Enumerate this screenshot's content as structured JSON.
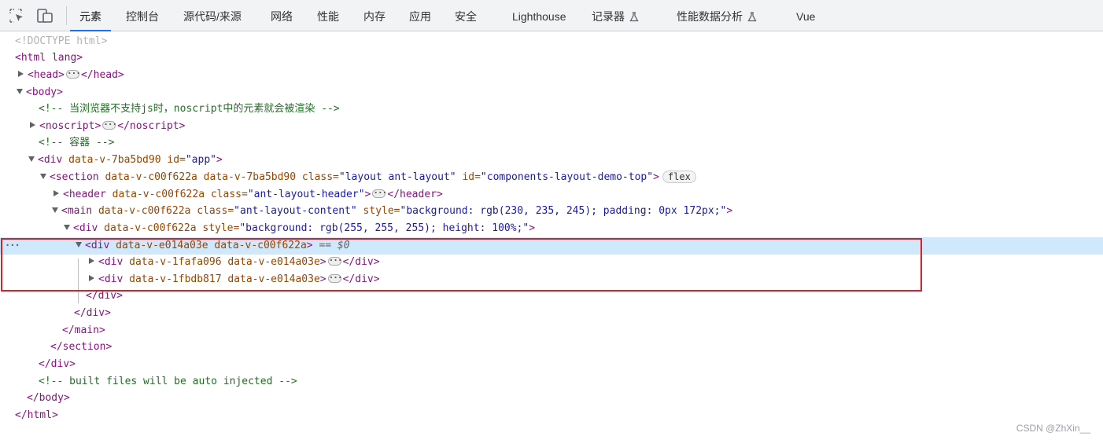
{
  "toolbar": {
    "icons": [
      "inspect-element-icon",
      "device-toolbar-icon"
    ],
    "tabs": [
      {
        "label": "元素",
        "active": true
      },
      {
        "label": "控制台"
      },
      {
        "label": "源代码/来源"
      },
      {
        "label": "网络"
      },
      {
        "label": "性能"
      },
      {
        "label": "内存"
      },
      {
        "label": "应用"
      },
      {
        "label": "安全"
      },
      {
        "label": "Lighthouse"
      },
      {
        "label": "记录器",
        "flask": true
      },
      {
        "label": "性能数据分析",
        "flask": true
      },
      {
        "label": "Vue"
      }
    ]
  },
  "tree": {
    "doctype": "<!DOCTYPE html>",
    "html_open": "<html lang>",
    "head_open": "<head>",
    "head_close": "</head>",
    "body_open": "<body>",
    "comment1": "<!-- 当浏览器不支持js时，noscript中的元素就会被渲染 -->",
    "noscript_open": "<noscript>",
    "noscript_close": "</noscript>",
    "comment2": "<!-- 容器 -->",
    "app_div": {
      "tag": "<div",
      "a1": "data-v-7ba5bd90",
      "a2": "id=",
      "v2": "\"app\"",
      "end": ">"
    },
    "section": {
      "tag": "<section",
      "a1": "data-v-c00f622a data-v-7ba5bd90",
      "a2": "class=",
      "v2": "\"layout ant-layout\"",
      "a3": "id=",
      "v3": "\"components-layout-demo-top\"",
      "end": ">",
      "badge": "flex"
    },
    "header": {
      "tag": "<header",
      "a1": "data-v-c00f622a",
      "a2": "class=",
      "v2": "\"ant-layout-header\"",
      "end": ">",
      "close": "</header>"
    },
    "main": {
      "tag": "<main",
      "a1": "data-v-c00f622a",
      "a2": "class=",
      "v2": "\"ant-layout-content\"",
      "a3": "style=",
      "v3": "\"background: rgb(230, 235, 245); padding: 0px 172px;\"",
      "end": ">"
    },
    "inner_div": {
      "tag": "<div",
      "a1": "data-v-c00f622a",
      "a2": "style=",
      "v2": "\"background: rgb(255, 255, 255); height: 100%;\"",
      "end": ">"
    },
    "selected_div": {
      "tag": "<div",
      "a1": "data-v-e014a03e data-v-c00f622a",
      "end": ">",
      "marker": "== $0"
    },
    "child1": {
      "tag": "<div",
      "a1": "data-v-1fafa096 data-v-e014a03e",
      "end": ">",
      "close": "</div>"
    },
    "child2": {
      "tag": "<div",
      "a1": "data-v-1fbdb817 data-v-e014a03e",
      "end": ">",
      "close": "</div>"
    },
    "div_close": "</div>",
    "main_close": "</main>",
    "section_close": "</section>",
    "comment3": "<!-- built files will be auto injected -->",
    "body_close": "</body>",
    "html_close": "</html>"
  },
  "watermark": "CSDN @ZhXin__",
  "colors": {
    "tag": "#881280",
    "attr": "#994500",
    "value": "#1a1aa6",
    "comment": "#236e25",
    "selection": "#cfe8fc",
    "highlight_box": "#e51c23",
    "active_tab": "#1a73e8"
  }
}
